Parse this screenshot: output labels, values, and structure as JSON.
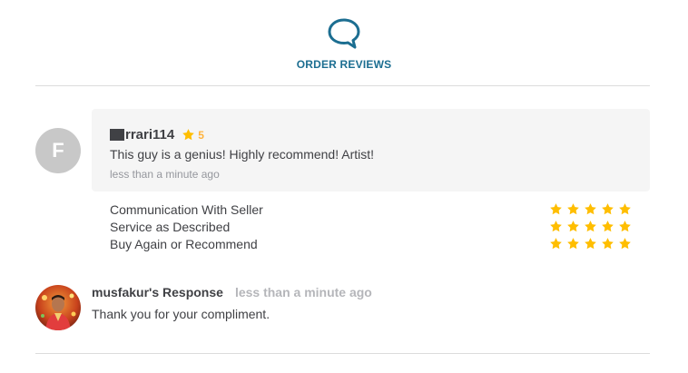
{
  "header": {
    "icon": "chat-bubble-icon",
    "title": "ORDER REVIEWS",
    "accent_color": "#1c6e91"
  },
  "review": {
    "avatar_initial": "F",
    "reviewer_name": "rrari114",
    "rating_icon": "star-icon",
    "rating_value": "5",
    "text": "This guy is a genius! Highly recommend! Artist!",
    "time": "less than a minute ago",
    "star_color": "#ffbe00"
  },
  "criteria": [
    {
      "label": "Communication With Seller",
      "stars": 5
    },
    {
      "label": "Service as Described",
      "stars": 5
    },
    {
      "label": "Buy Again or Recommend",
      "stars": 5
    }
  ],
  "response": {
    "avatar_icon": "seller-photo",
    "title": "musfakur's Response",
    "time": "less than a minute ago",
    "text": "Thank you for your compliment."
  }
}
